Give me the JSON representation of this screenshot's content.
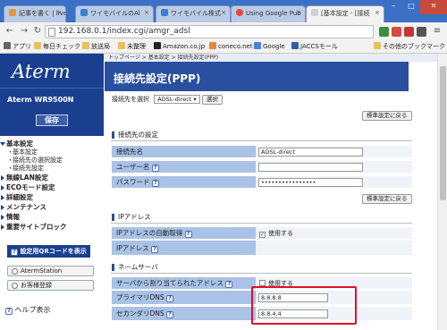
{
  "browser": {
    "tabs": [
      {
        "label": "記事を書く | live",
        "color": "#e6973a"
      },
      {
        "label": "ワイモバイルのAl",
        "color": "#3b7fd3"
      },
      {
        "label": "ワイモバイル株式",
        "color": "#3b7fd3"
      },
      {
        "label": "Using Google Pub",
        "color": "#e44b3c"
      },
      {
        "label": "[基本設定 - [接続",
        "color": "#cfcfcf"
      }
    ],
    "url": "192.168.0.1/index.cgi/amgr_adsl",
    "bookmarks": [
      "アプリ",
      "毎日チェック",
      "放送局",
      "未整理",
      "Amazon.co.jp",
      "coneco.net",
      "Google",
      "JACCSモール",
      "その他のブックマーク"
    ]
  },
  "sidebar": {
    "logo": "Aterm",
    "model": "Aterm  WR9500N",
    "save": "保存",
    "menu": [
      {
        "label": "基本設定",
        "open": true,
        "children": [
          "基本設定",
          "接続先の選択設定",
          "接続先設定"
        ]
      },
      {
        "label": "無線LAN設定"
      },
      {
        "label": "ECOモード設定"
      },
      {
        "label": "詳細設定"
      },
      {
        "label": "メンテナンス"
      },
      {
        "label": "情報"
      },
      {
        "label": "重要サイトブロック"
      }
    ],
    "qr": "設定用QRコードを表示",
    "buttons": [
      "AtermStation",
      "お客様登録"
    ],
    "help": "ヘルプ表示"
  },
  "main": {
    "breadcrumb": "トップページ > 基本設定 > 接続先設定(PPP)",
    "title": "接続先設定(PPP)",
    "select_label": "接続先を選択",
    "select_value": "ADSL-direct",
    "select_button": "選択",
    "restore": "標準設定に戻る",
    "section1": {
      "title": "接続先の設定",
      "rows": [
        {
          "label": "接続先名",
          "value": "ADSL-direct"
        },
        {
          "label": "ユーザー名",
          "value": ""
        },
        {
          "label": "パスワード",
          "value": "••••••••••••••••"
        }
      ]
    },
    "section2": {
      "title": "IPアドレス",
      "rows": [
        {
          "label": "IPアドレスの自動取得",
          "value": "使用する",
          "checked": true
        },
        {
          "label": "IPアドレス",
          "value": ""
        }
      ]
    },
    "section3": {
      "title": "ネームサーバ",
      "rows": [
        {
          "label": "サーバから割り当てられたアドレス",
          "value": "使用する",
          "checked": false
        },
        {
          "label": "プライマリDNS",
          "value": "8.8.8.8"
        },
        {
          "label": "セカンダリDNS",
          "value": "8.8.4.4"
        }
      ]
    }
  }
}
